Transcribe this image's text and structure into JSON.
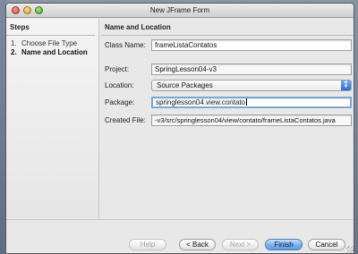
{
  "window": {
    "title": "New JFrame Form"
  },
  "steps": {
    "heading": "Steps",
    "items": [
      {
        "number": "1.",
        "label": "Choose File Type",
        "current": false
      },
      {
        "number": "2.",
        "label": "Name and Location",
        "current": true
      }
    ]
  },
  "form": {
    "heading": "Name and Location",
    "class_name": {
      "label": "Class Name:",
      "value": "frameListaContatos"
    },
    "project": {
      "label": "Project:",
      "value": "SpringLesson04-v3"
    },
    "location": {
      "label": "Location:",
      "value": "Source Packages"
    },
    "package": {
      "label": "Package:",
      "value": "springlesson04.view.contato"
    },
    "created_file": {
      "label": "Created File:",
      "value": "-v3/src/springlesson04/view/contato/frameListaContatos.java"
    }
  },
  "buttons": {
    "help": "Help",
    "back": "< Back",
    "next": "Next >",
    "finish": "Finish",
    "cancel": "Cancel"
  },
  "colors": {
    "accent": "#5d9de6",
    "focus_ring": "#7aa7d8"
  }
}
